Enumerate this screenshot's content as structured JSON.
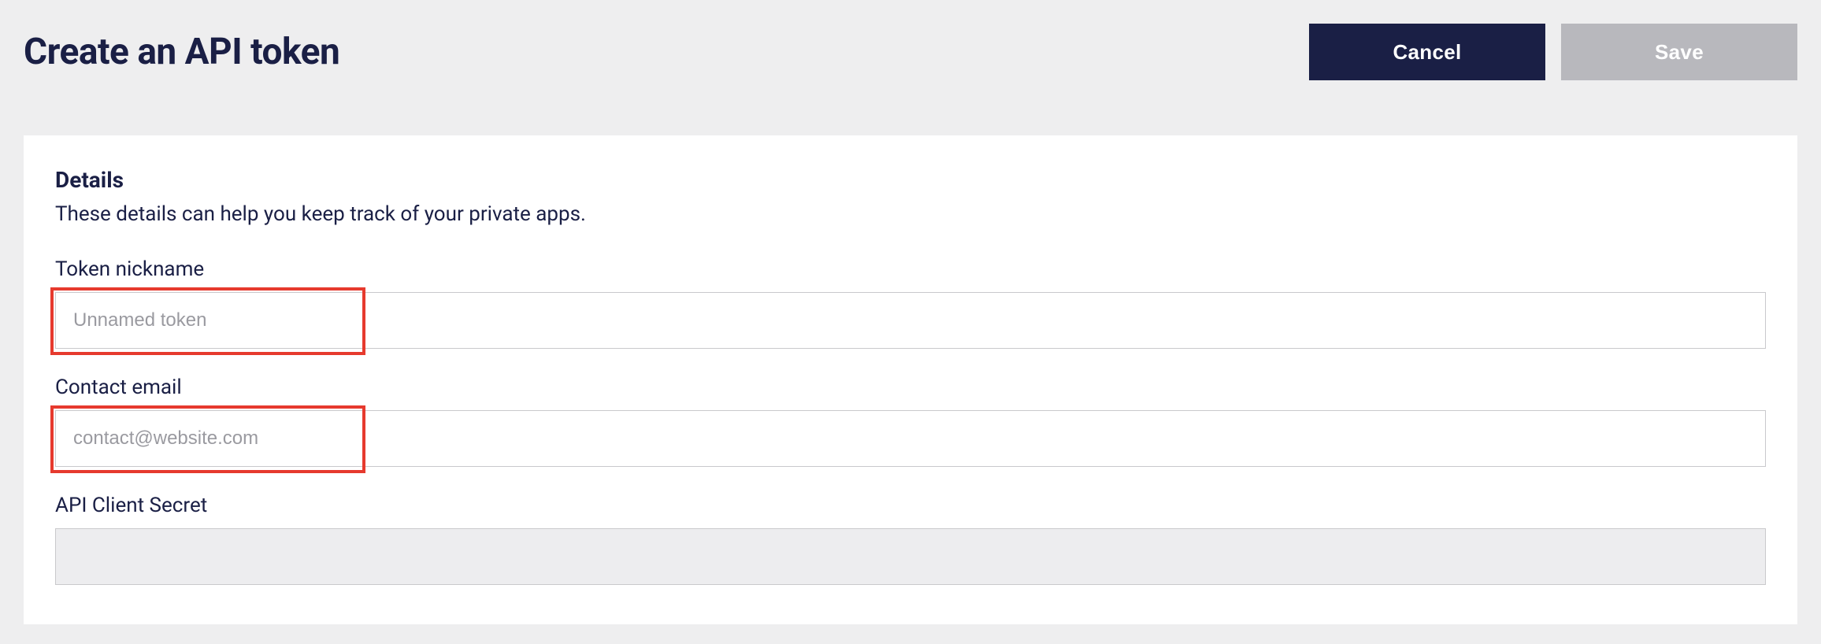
{
  "header": {
    "title": "Create an API token",
    "cancel_label": "Cancel",
    "save_label": "Save"
  },
  "details": {
    "heading": "Details",
    "description": "These details can help you keep track of your private apps.",
    "fields": {
      "nickname": {
        "label": "Token nickname",
        "placeholder": "Unnamed token",
        "value": ""
      },
      "email": {
        "label": "Contact email",
        "placeholder": "contact@website.com",
        "value": ""
      },
      "client_secret": {
        "label": "API Client Secret",
        "value": ""
      }
    }
  }
}
